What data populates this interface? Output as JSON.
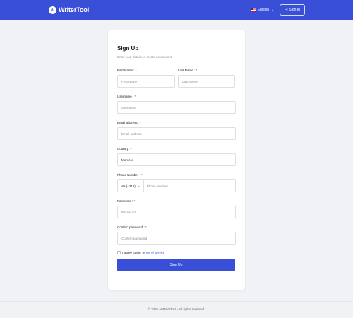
{
  "header": {
    "logo_mark": "AI",
    "brand": "WriterTool",
    "language": "English",
    "signin_label": "Sign In"
  },
  "form": {
    "title": "Sign Up",
    "subtitle": "Enter your details to create an account.",
    "first_name": {
      "label": "First Name :",
      "placeholder": "First Name"
    },
    "last_name": {
      "label": "Last Name :",
      "placeholder": "Last Name"
    },
    "username": {
      "label": "Username :",
      "placeholder": "Username"
    },
    "email": {
      "label": "Email address :",
      "placeholder": "Email address"
    },
    "country": {
      "label": "Country :",
      "value": "Morocco"
    },
    "phone": {
      "label": "Phone Number :",
      "country_code": "MA (+212)",
      "placeholder": "Phone Number"
    },
    "password": {
      "label": "Password :",
      "placeholder": "Password"
    },
    "confirm_password": {
      "label": "Confirm password :",
      "placeholder": "Confirm password"
    },
    "required_mark": "*",
    "agree_text": "I agree to the",
    "terms_link": "terms of service",
    "submit_label": "Sign Up"
  },
  "footer": {
    "text": "© 2025 AIWriterTool - All rights reserved."
  },
  "colors": {
    "primary": "#3a4fd8",
    "background": "#f1f2f6",
    "required": "#dd3333"
  }
}
